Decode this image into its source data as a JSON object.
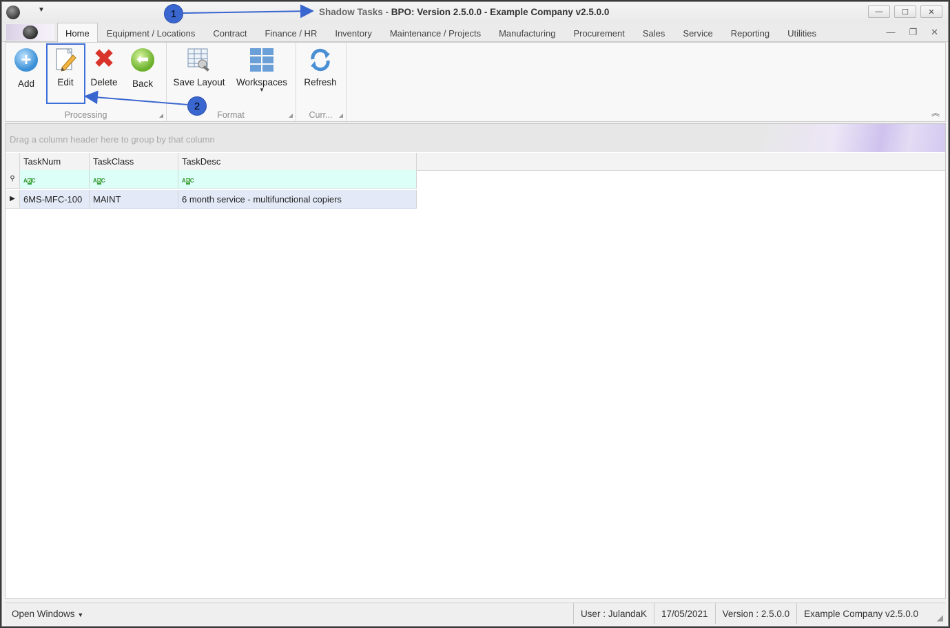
{
  "window": {
    "title_prefix": "Shadow Tasks - ",
    "title_main": "BPO: Version 2.5.0.0 - Example Company v2.5.0.0",
    "min_glyph": "—",
    "max_glyph": "☐",
    "close_glyph": "✕"
  },
  "menu": {
    "tabs": [
      "Home",
      "Equipment / Locations",
      "Contract",
      "Finance / HR",
      "Inventory",
      "Maintenance / Projects",
      "Manufacturing",
      "Procurement",
      "Sales",
      "Service",
      "Reporting",
      "Utilities"
    ],
    "active_tab": "Home"
  },
  "ribbon": {
    "processing": {
      "label": "Processing",
      "add": "Add",
      "edit": "Edit",
      "delete": "Delete",
      "back": "Back"
    },
    "format": {
      "label": "Format",
      "save_layout": "Save Layout",
      "workspaces": "Workspaces"
    },
    "current": {
      "label": "Curr...",
      "refresh": "Refresh"
    }
  },
  "grid": {
    "group_panel_text": "Drag a column header here to group by that column",
    "columns": [
      "TaskNum",
      "TaskClass",
      "TaskDesc"
    ],
    "rows": [
      {
        "TaskNum": "6MS-MFC-100",
        "TaskClass": "MAINT",
        "TaskDesc": "6 month service - multifunctional copiers"
      }
    ]
  },
  "status": {
    "open_windows": "Open Windows",
    "user": "User : JulandaK",
    "date": "17/05/2021",
    "version": "Version : 2.5.0.0",
    "company": "Example Company v2.5.0.0"
  },
  "annotations": {
    "badge1": "1",
    "badge2": "2"
  },
  "colors": {
    "annotation_blue": "#3a66cf",
    "filter_row": "#dcfff7",
    "selected_row": "#e3e9f6"
  }
}
